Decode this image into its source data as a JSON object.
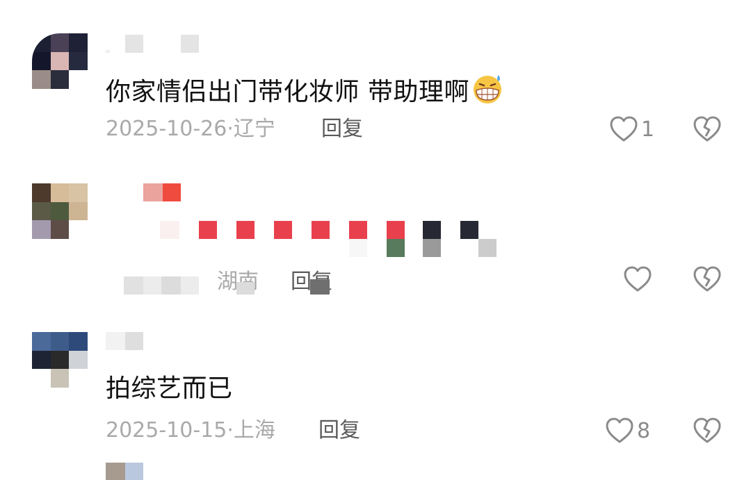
{
  "comments": [
    {
      "text": "你家情侣出门带化妆师 带助理啊",
      "emoji": "grimacing-sweat-emoji",
      "date": "2025-10-26",
      "location": "辽宁",
      "reply_label": "回复",
      "likes": "1"
    },
    {
      "text": "",
      "date": "",
      "location": "湖南",
      "reply_label": "回复",
      "likes": ""
    },
    {
      "text": "拍综艺而已",
      "date": "2025-10-15",
      "location": "上海",
      "reply_label": "回复",
      "likes": "8"
    }
  ],
  "icons": {
    "like": "heart-outline-icon",
    "dislike": "broken-heart-icon"
  },
  "colors": {
    "text": "#111111",
    "meta": "#a9a9a9",
    "icon": "#8a8a8a",
    "pixel_red": "#e8414d"
  }
}
